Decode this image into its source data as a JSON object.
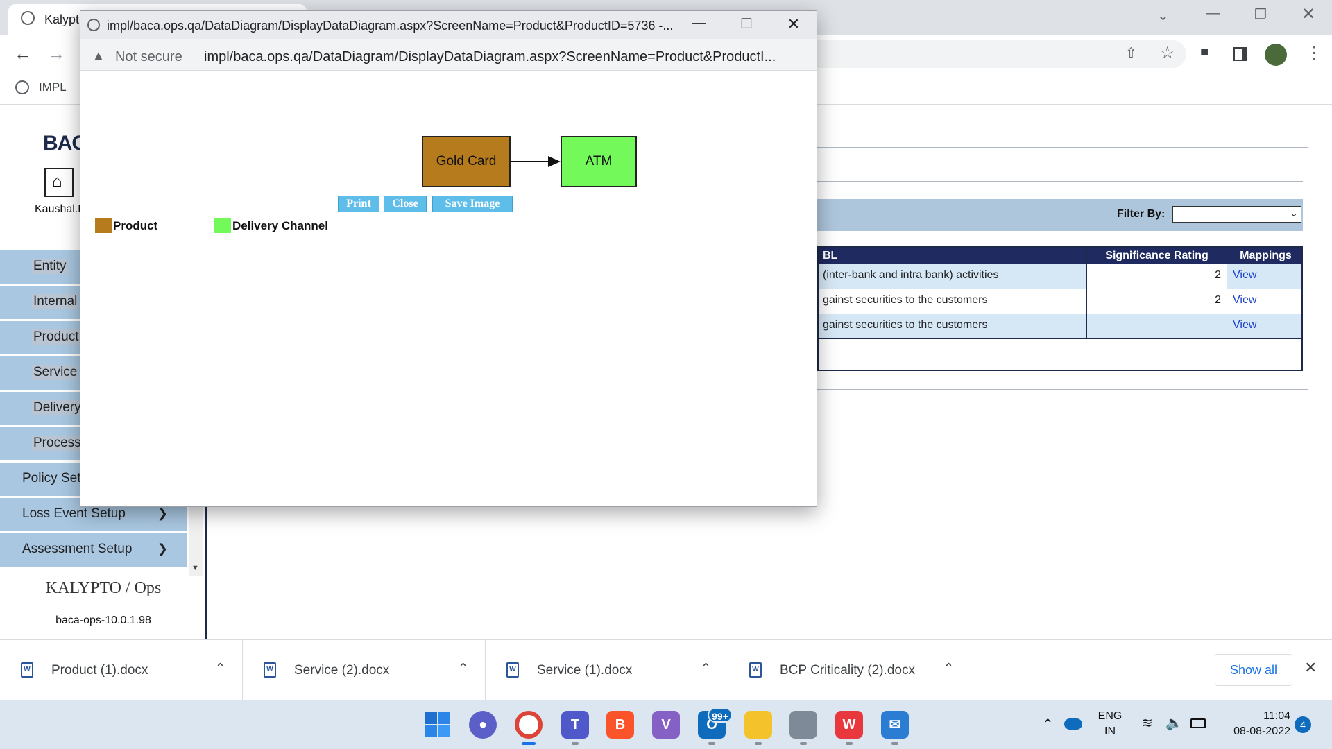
{
  "browser": {
    "tab_title": "Kalypt",
    "bookmark": "IMPL"
  },
  "popup": {
    "title": "impl/baca.ops.qa/DataDiagram/DisplayDataDiagram.aspx?ScreenName=Product&ProductID=5736 -...",
    "security": "Not secure",
    "url": "impl/baca.ops.qa/DataDiagram/DisplayDataDiagram.aspx?ScreenName=Product&ProductI...",
    "nodes": {
      "source": "Gold Card",
      "target": "ATM"
    },
    "buttons": {
      "print": "Print",
      "close": "Close",
      "save": "Save Image"
    },
    "legend": [
      {
        "label": "Product",
        "color": "#b57b1c"
      },
      {
        "label": "Delivery Channel",
        "color": "#73f95a"
      }
    ]
  },
  "sidebar": {
    "brand": "BAC",
    "user": "Kaushal.P",
    "items": [
      "Entity",
      "Internal",
      "Product",
      "Service",
      "Delivery",
      "Process"
    ],
    "setup_items": [
      "Policy Setu",
      "Loss Event Setup",
      "Assessment Setup"
    ],
    "footer_logo": "KALYPTO / Ops",
    "version": "baca-ops-10.0.1.98"
  },
  "main": {
    "filter_label": "Filter By:",
    "grid": {
      "headers": [
        "BL",
        "Significance Rating",
        "Mappings"
      ],
      "rows": [
        {
          "text": "(inter-bank and intra bank) activities",
          "rating": "2",
          "link": "View"
        },
        {
          "text": "gainst securities to the customers",
          "rating": "2",
          "link": "View"
        },
        {
          "text": "gainst securities to the customers",
          "rating": "",
          "link": "View"
        }
      ]
    }
  },
  "downloads": {
    "items": [
      "Product (1).docx",
      "Service (2).docx",
      "Service (1).docx",
      "BCP Criticality (2).docx"
    ],
    "show_all": "Show all"
  },
  "taskbar": {
    "mail_badge": "99+",
    "lang": "ENG",
    "region": "IN",
    "time": "11:04",
    "date": "08-08-2022",
    "notifications": "4"
  }
}
